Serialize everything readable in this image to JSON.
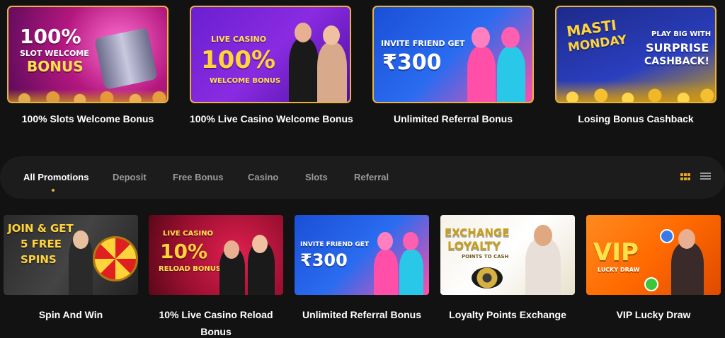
{
  "featured": [
    {
      "title": "100% Slots Welcome Bonus",
      "banner_lines": [
        "100%",
        "SLOT WELCOME",
        "BONUS"
      ]
    },
    {
      "title": "100% Live Casino Welcome Bonus",
      "banner_lines": [
        "LIVE CASINO",
        "100%",
        "WELCOME BONUS"
      ]
    },
    {
      "title": "Unlimited Referral Bonus",
      "banner_lines": [
        "INVITE FRIEND GET",
        "₹300"
      ]
    },
    {
      "title": "Losing Bonus Cashback",
      "banner_lines": [
        "MASTI",
        "MONDAY",
        "PLAY BIG WITH",
        "SURPRISE",
        "CASHBACK!"
      ]
    }
  ],
  "tabs": [
    {
      "label": "All Promotions",
      "active": true
    },
    {
      "label": "Deposit"
    },
    {
      "label": "Free Bonus"
    },
    {
      "label": "Casino"
    },
    {
      "label": "Slots"
    },
    {
      "label": "Referral"
    }
  ],
  "view_toggle": {
    "grid_icon": "grid-view-icon",
    "list_icon": "list-view-icon",
    "active": "grid",
    "accent": "#e8a423"
  },
  "promotions": [
    {
      "title": "Spin And Win",
      "banner_lines": [
        "JOIN & GET",
        "5 FREE",
        "SPINS"
      ]
    },
    {
      "title": "10% Live Casino Reload Bonus",
      "banner_lines": [
        "LIVE CASINO",
        "10%",
        "RELOAD BONUS"
      ]
    },
    {
      "title": "Unlimited Referral Bonus",
      "banner_lines": [
        "INVITE FRIEND GET",
        "₹300"
      ]
    },
    {
      "title": "Loyalty Points Exchange",
      "banner_lines": [
        "EXCHANGE",
        "LOYALTY",
        "POINTS TO CASH"
      ]
    },
    {
      "title": "VIP Lucky Draw",
      "banner_lines": [
        "VIP",
        "LUCKY DRAW"
      ]
    }
  ],
  "colors": {
    "background": "#121212",
    "accent_gold": "#e8b53a",
    "tabbar": "#1c1c1c"
  }
}
